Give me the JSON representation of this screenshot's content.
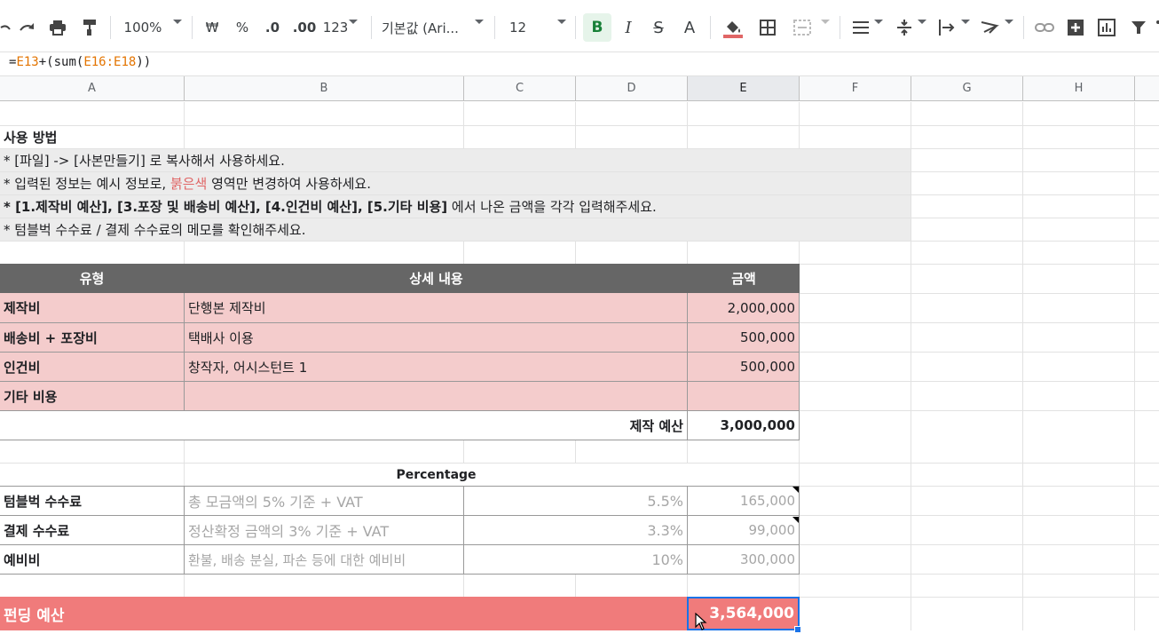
{
  "toolbar": {
    "zoom": "100%",
    "currency": "₩",
    "percent": "%",
    "dec_less": ".0",
    "dec_more": ".00",
    "format_more": "123",
    "font": "기본값 (Ari...",
    "font_size": "12",
    "bold": "B",
    "italic": "I",
    "strike": "S",
    "text_color": "A"
  },
  "formula_bar": {
    "prefix": "=",
    "ref1": "E13",
    "middle": "+(sum(",
    "ref2": "E16:E18",
    "suffix": "))"
  },
  "columns": [
    "A",
    "B",
    "C",
    "D",
    "E",
    "F",
    "G",
    "H"
  ],
  "instructions": {
    "title": "사용 방법",
    "line1": "* [파일] -> [사본만들기] 로 복사해서 사용하세요.",
    "line2_a": "* 입력된 정보는 예시 정보로, ",
    "line2_red": "붉은색",
    "line2_b": " 영역만 변경하여 사용하세요.",
    "line3_bold": "* [1.제작비 예산], [3.포장 및 배송비 예산], [4.인건비 예산], [5.기타 비용]",
    "line3_rest": " 에서 나온 금액을 각각 입력해주세요.",
    "line4": "* 텀블벅 수수료 / 결제 수수료의 메모를 확인해주세요."
  },
  "budget_table": {
    "headers": [
      "유형",
      "상세 내용",
      "금액"
    ],
    "rows": [
      {
        "type": "제작비",
        "detail": "단행본 제작비",
        "amount": "2,000,000"
      },
      {
        "type": "배송비 + 포장비",
        "detail": "택배사 이용",
        "amount": "500,000"
      },
      {
        "type": "인건비",
        "detail": "창작자, 어시스턴트 1",
        "amount": "500,000"
      },
      {
        "type": "기타 비용",
        "detail": "",
        "amount": ""
      }
    ],
    "total_label": "제작 예산",
    "total_value": "3,000,000"
  },
  "fee_table": {
    "percentage_header": "Percentage",
    "rows": [
      {
        "type": "텀블벅 수수료",
        "detail": "총 모금액의 5% 기준 + VAT",
        "percent": "5.5%",
        "amount": "165,000"
      },
      {
        "type": "결제 수수료",
        "detail": "정산확정 금액의 3% 기준 + VAT",
        "percent": "3.3%",
        "amount": "99,000"
      },
      {
        "type": "예비비",
        "detail": "환불, 배송 분실, 파손 등에 대한 예비비",
        "percent": "10%",
        "amount": "300,000"
      }
    ]
  },
  "funding": {
    "label": "펀딩 예산",
    "value": "3,564,000"
  },
  "colors": {
    "header_gray": "#666666",
    "pink": "#f4cccc",
    "fund_red": "#f07b7b",
    "selection_blue": "#1a73e8",
    "red_text": "#e06666"
  }
}
